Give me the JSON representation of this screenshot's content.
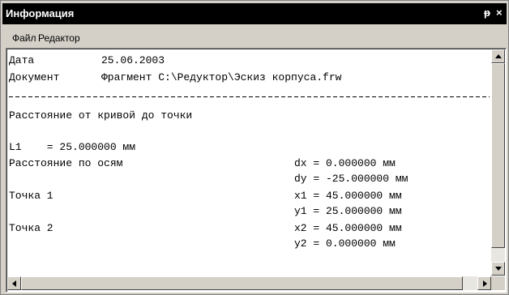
{
  "window": {
    "title": "Информация",
    "pin_glyph": "ᵽ",
    "close_glyph": "×"
  },
  "menu": {
    "items": [
      "Файл",
      "Редактор"
    ]
  },
  "report": {
    "date_label": "Дата",
    "date_value": "25.06.2003",
    "doc_label": "Документ",
    "doc_value": "Фрагмент C:\\Редуктор\\Эскиз корпуса.frw",
    "section_title": "Расстояние от кривой до точки",
    "l1_line": "L1    = 25.000000 мм",
    "axes_label": "Расстояние по осям",
    "dx_line": "dx = 0.000000 мм",
    "dy_line": "dy = -25.000000 мм",
    "point1_label": "Точка 1",
    "x1_line": "x1 = 45.000000 мм",
    "y1_line": "y1 = 25.000000 мм",
    "point2_label": "Точка 2",
    "x2_line": "x2 = 45.000000 мм",
    "y2_line": "y2 = 0.000000 мм"
  },
  "icons": {
    "pin": "pin-icon",
    "close": "close-icon",
    "scroll_up": "arrow-up-icon",
    "scroll_down": "arrow-down-icon",
    "scroll_left": "arrow-left-icon",
    "scroll_right": "arrow-right-icon"
  },
  "colors": {
    "titlebar": "#000000",
    "face": "#d4d0c8",
    "content_bg": "#ffffff"
  }
}
